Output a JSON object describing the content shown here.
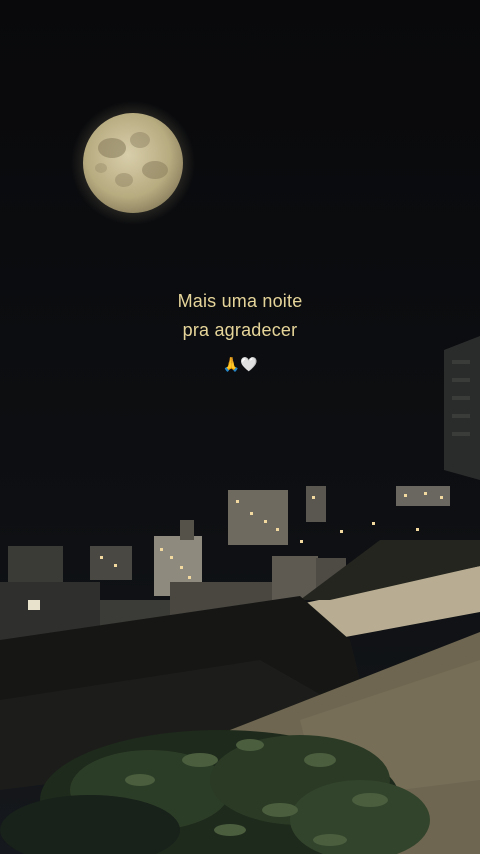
{
  "caption": {
    "line1": "Mais uma noite",
    "line2": "pra agradecer",
    "emojis": "🙏🤍",
    "color": "#e6d59a"
  },
  "scene": {
    "sky_color": "#0b0c0e",
    "moon_color": "#c9bd94",
    "city_light_color": "#f2d9a0"
  }
}
